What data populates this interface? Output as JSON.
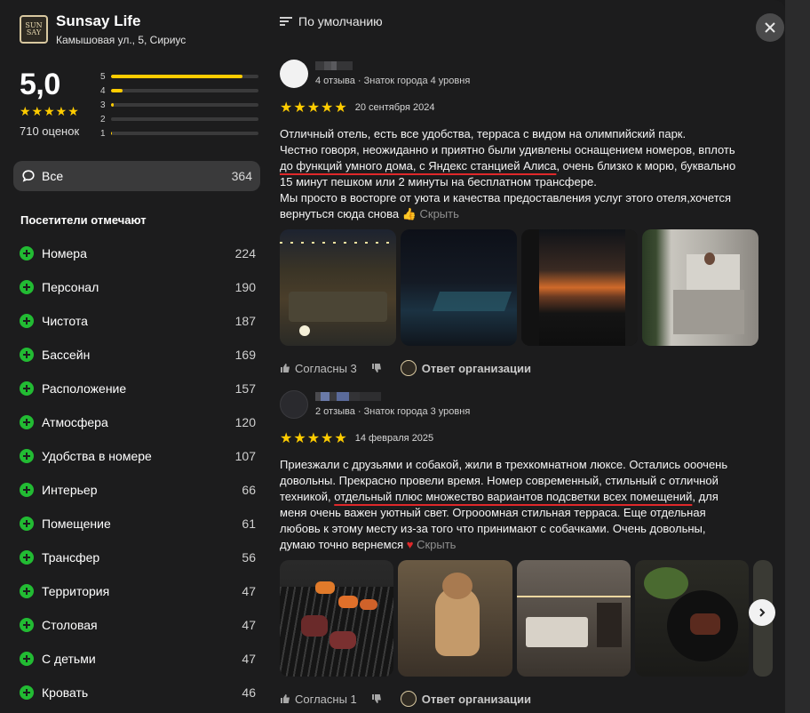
{
  "org": {
    "name": "Sunsay Life",
    "address": "Камышовая ул., 5, Сириус",
    "logo_text": "SUN SAY"
  },
  "rating": {
    "value": "5,0",
    "stars": "★★★★★",
    "count_label": "710 оценок",
    "distribution": [
      {
        "label": "5",
        "fraction": 0.89
      },
      {
        "label": "4",
        "fraction": 0.08
      },
      {
        "label": "3",
        "fraction": 0.02
      },
      {
        "label": "2",
        "fraction": 0.0
      },
      {
        "label": "1",
        "fraction": 0.005
      }
    ]
  },
  "filter_all": {
    "label": "Все",
    "count": "364"
  },
  "tags_title": "Посетители отмечают",
  "tags": [
    {
      "name": "Номера",
      "count": "224"
    },
    {
      "name": "Персонал",
      "count": "190"
    },
    {
      "name": "Чистота",
      "count": "187"
    },
    {
      "name": "Бассейн",
      "count": "169"
    },
    {
      "name": "Расположение",
      "count": "157"
    },
    {
      "name": "Атмосфера",
      "count": "120"
    },
    {
      "name": "Удобства в номере",
      "count": "107"
    },
    {
      "name": "Интерьер",
      "count": "66"
    },
    {
      "name": "Помещение",
      "count": "61"
    },
    {
      "name": "Трансфер",
      "count": "56"
    },
    {
      "name": "Территория",
      "count": "47"
    },
    {
      "name": "Столовая",
      "count": "47"
    },
    {
      "name": "С детьми",
      "count": "47"
    },
    {
      "name": "Кровать",
      "count": "46"
    }
  ],
  "sort_label": "По умолчанию",
  "reviews": [
    {
      "meta": "4 отзыва · Знаток города 4 уровня",
      "stars": "★★★★★",
      "date": "20 сентября 2024",
      "lines": [
        {
          "a": "Отличный отель, есть все удобства, терраса с видом на олимпийский парк."
        },
        {
          "a": "Честно говоря, неожиданно и приятно были удивлены оснащением номеров, вплоть"
        },
        {
          "u": "до функций умного дома, с Яндекс станцией Алиса",
          "b": ", очень близко к морю, буквально"
        },
        {
          "a": "15 минут пешком или 2 минуты на бесплатном трансфере."
        },
        {
          "a": "Мы просто в восторге от уюта и качества предоставления услуг этого отеля,хочется"
        },
        {
          "a": "вернуться сюда снова ",
          "emoji": "👍",
          "hide": " Скрыть"
        }
      ],
      "likes": "Согласны 3",
      "reply": "Ответ организации"
    },
    {
      "meta": "2 отзыва · Знаток города 3 уровня",
      "stars": "★★★★★",
      "date": "14 февраля 2025",
      "lines": [
        {
          "a": "Приезжали с друзьями и собакой, жили в трехкомнатном люксе. Остались ооочень"
        },
        {
          "a": "довольны. Прекрасно провели время. Номер современный, стильный с отличной"
        },
        {
          "a": "техникой, ",
          "u": "отдельный плюс множество вариантов подсветки всех помещений",
          "b": ", для"
        },
        {
          "a": "меня очень важен уютный свет. Огрооомная стильная терраса. Еще отдельная"
        },
        {
          "a": "любовь к этому месту из-за того что принимают с собачками. Очень довольны,"
        },
        {
          "a": "думаю точно вернемся ",
          "heart": "♥",
          "hide": " Скрыть"
        }
      ],
      "likes": "Согласны 1",
      "reply": "Ответ организации"
    }
  ]
}
